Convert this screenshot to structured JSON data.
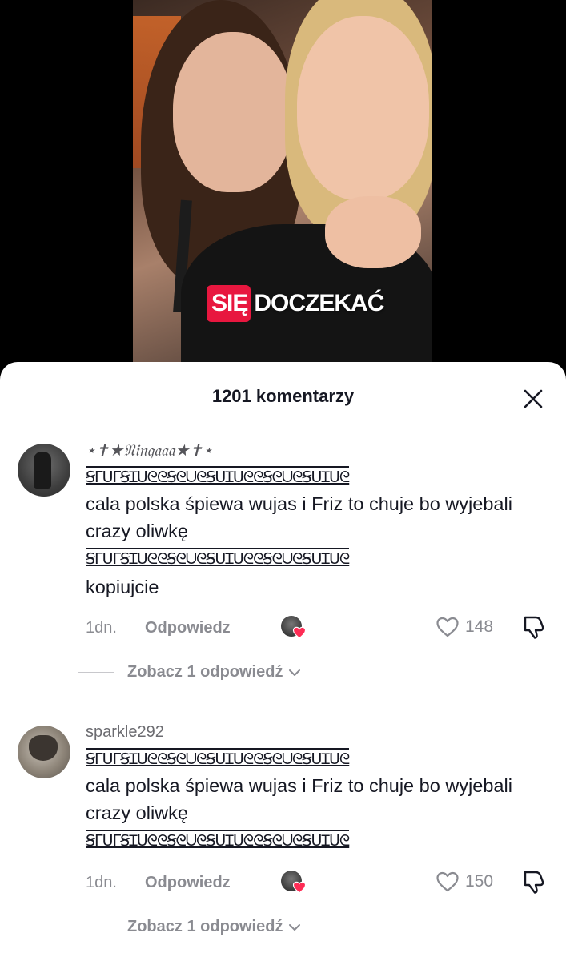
{
  "video": {
    "caption_highlight": "SIĘ",
    "caption_rest": "DOCZEKAĆ"
  },
  "comments_panel": {
    "title": "1201 komentarzy"
  },
  "comments": [
    {
      "username": "⋆✝︎★𝔑𝔦𝔫𝔮𝔞𝔞𝔞★✝︎⋆",
      "deco_line": "ꞨᒥᑌᒥꞨꞮᑌᘓᘓꞨᘓᑌᘓꞨᑌꞮᑌᘓᘓꞨᘓᑌᘓꞨᑌꞮᑌᘓ",
      "text": "cala polska śpiewa wujas i Friz to chuje bo wyjebali crazy oliwkę",
      "deco_line2": "ꞨᒥᑌᒥꞨꞮᑌᘓᘓꞨᘓᑌᘓꞨᑌꞮᑌᘓᘓꞨᘓᑌᘓꞨᑌꞮᑌᘓ",
      "text2": "kopiujcie",
      "date": "1dn.",
      "reply_label": "Odpowiedz",
      "likes": "148",
      "view_replies": "Zobacz 1 odpowiedź"
    },
    {
      "username": "sparkle292",
      "deco_line": "ꞨᒥᑌᒥꞨꞮᑌᘓᘓꞨᘓᑌᘓꞨᑌꞮᑌᘓᘓꞨᘓᑌᘓꞨᑌꞮᑌᘓ",
      "text": "cala polska śpiewa wujas i Friz to chuje bo wyjebali crazy oliwkę",
      "deco_line2": "ꞨᒥᑌᒥꞨꞮᑌᘓᘓꞨᘓᑌᘓꞨᑌꞮᑌᘓᘓꞨᘓᑌᘓꞨᑌꞮᑌᘓ",
      "date": "1dn.",
      "reply_label": "Odpowiedz",
      "likes": "150",
      "view_replies": "Zobacz 1 odpowiedź"
    }
  ],
  "colors": {
    "caption_red": "#e8173f",
    "creator_heart": "#fe2c55",
    "text_primary": "#161823",
    "text_secondary": "#8a8b91"
  },
  "icons": [
    "close-icon",
    "heart-outline-icon",
    "dislike-icon",
    "chevron-down-icon",
    "creator-liked-heart-icon"
  ]
}
